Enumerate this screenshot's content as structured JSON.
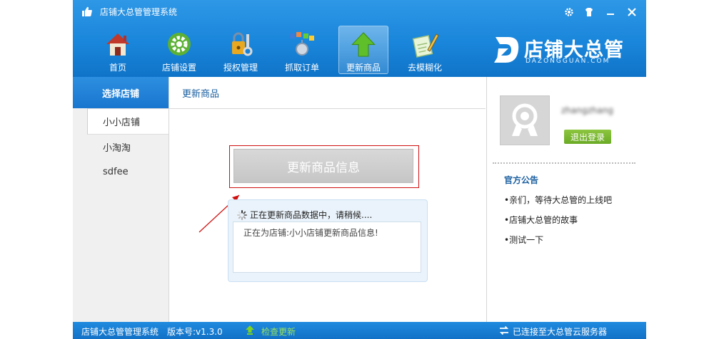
{
  "window": {
    "title": "店铺大总管管理系统"
  },
  "toolbar": {
    "items": [
      {
        "label": "首页",
        "icon": "home-icon"
      },
      {
        "label": "店铺设置",
        "icon": "gear-icon"
      },
      {
        "label": "授权管理",
        "icon": "lock-key-icon"
      },
      {
        "label": "抓取订单",
        "icon": "grab-orders-icon"
      },
      {
        "label": "更新商品",
        "icon": "up-arrow-icon",
        "active": true
      },
      {
        "label": "去模糊化",
        "icon": "edit-pencil-icon"
      }
    ]
  },
  "logo": {
    "text": "店铺大总管",
    "sub": "DAZONGGUAN.COM"
  },
  "left": {
    "header": "选择店铺",
    "shops": [
      "小小店铺",
      "小淘淘",
      "sdfee"
    ],
    "selected": 0
  },
  "main": {
    "header": "更新商品",
    "update_button": "更新商品信息",
    "progress_title": "正在更新商品数据中，请稍候....",
    "progress_log": "正在为店铺:小小店铺更新商品信息!"
  },
  "right": {
    "username": "zhangzhang",
    "logout": "退出登录",
    "notice_title": "官方公告",
    "notices": [
      "•亲们，等待大总管的上线吧",
      "•店铺大总管的故事",
      "•测试一下"
    ]
  },
  "status": {
    "app_name": "店铺大总管管理系统",
    "version": "版本号:v1.3.0",
    "check_update": "检查更新",
    "connection": "已连接至大总管云服务器"
  },
  "colors": {
    "header_blue": "#1a86db",
    "alert_red": "#d01010",
    "green": "#7ab82e"
  }
}
